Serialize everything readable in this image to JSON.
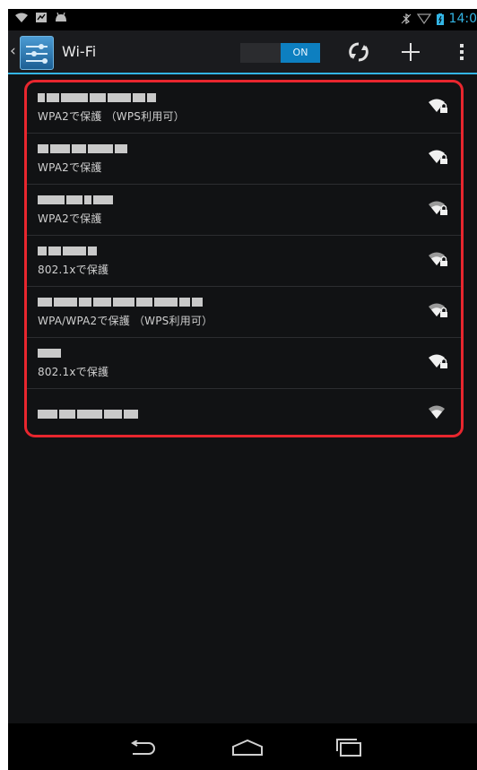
{
  "status_bar": {
    "time": "14:0",
    "icons": [
      "wifi-icon",
      "notification-icon",
      "android-icon",
      "bluetooth-muted-icon",
      "signal-icon",
      "battery-icon"
    ]
  },
  "action_bar": {
    "title": "Wi-Fi",
    "toggle_state": "ON",
    "accent_color": "#33b5e5",
    "actions": [
      "wps-icon",
      "add-network-icon",
      "overflow-menu-icon"
    ]
  },
  "networks": [
    {
      "ssid": "",
      "security": "WPA2で保護 （WPS利用可）",
      "secured": true
    },
    {
      "ssid": "",
      "security": "WPA2で保護",
      "secured": true
    },
    {
      "ssid": "",
      "security": "WPA2で保護",
      "secured": true
    },
    {
      "ssid": "",
      "security": "802.1xで保護",
      "secured": true
    },
    {
      "ssid": "",
      "security": "WPA/WPA2で保護 （WPS利用可）",
      "secured": true
    },
    {
      "ssid": "",
      "security": "802.1xで保護",
      "secured": true
    },
    {
      "ssid": "",
      "security": "",
      "secured": false
    }
  ],
  "highlight_color": "#e8262e",
  "nav_bar": [
    "back-icon",
    "home-icon",
    "recent-apps-icon"
  ]
}
